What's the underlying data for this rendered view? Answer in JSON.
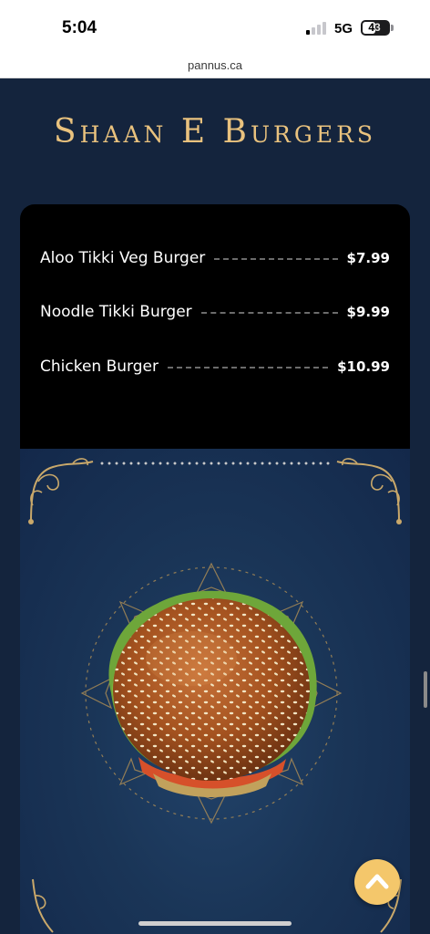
{
  "status_bar": {
    "time": "5:04",
    "network": "5G",
    "battery": "43",
    "signal_bars_on": 1
  },
  "browser": {
    "url": "pannus.ca"
  },
  "header": {
    "title": "Shaan E Burgers",
    "accent_color": "#e9c27e"
  },
  "menu": {
    "items": [
      {
        "name": "Aloo Tikki Veg Burger",
        "price": "$7.99"
      },
      {
        "name": "Noodle Tikki Burger",
        "price": "$9.99"
      },
      {
        "name": "Chicken Burger",
        "price": "$10.99"
      }
    ]
  },
  "icons": {
    "scroll_to_top": "chevron-up-icon",
    "hero_image": "burger-image"
  },
  "colors": {
    "page_background": "#14243d",
    "card_background": "#000000",
    "button": "#f4c76b"
  }
}
